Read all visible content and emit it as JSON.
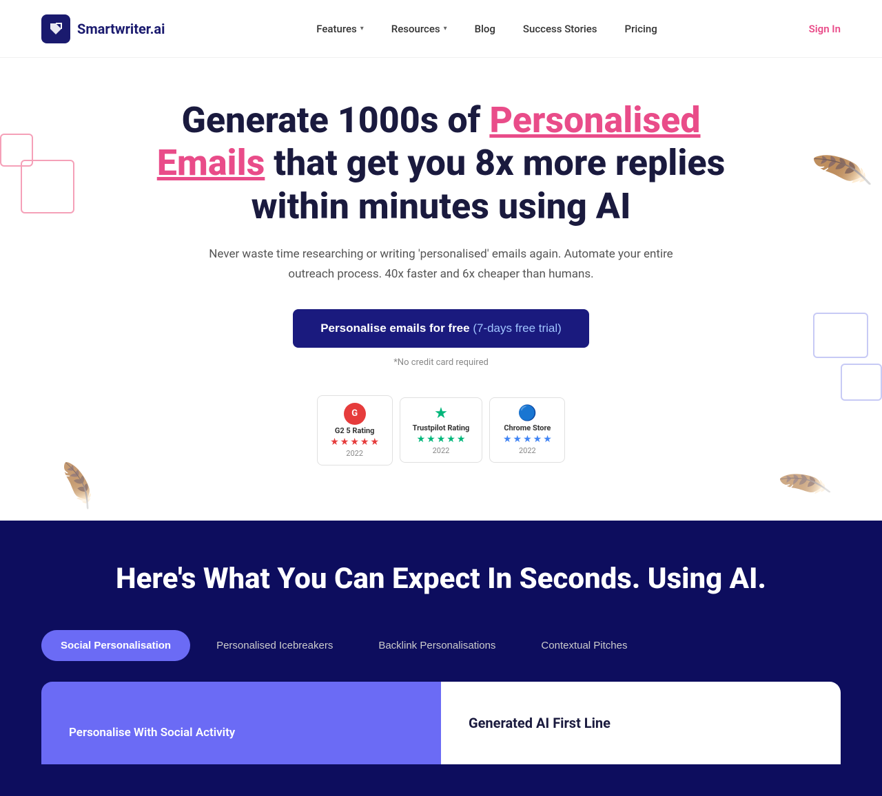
{
  "navbar": {
    "logo_text": "Smartwriter.ai",
    "nav_items": [
      {
        "label": "Features",
        "has_dropdown": true
      },
      {
        "label": "Resources",
        "has_dropdown": true
      },
      {
        "label": "Blog",
        "has_dropdown": false
      },
      {
        "label": "Success Stories",
        "has_dropdown": false
      },
      {
        "label": "Pricing",
        "has_dropdown": false
      }
    ],
    "sign_in": "Sign In"
  },
  "hero": {
    "title_start": "Generate 1000s of ",
    "title_highlight": "Personalised Emails",
    "title_end": " that get you 8x more replies within minutes using AI",
    "subtitle": "Never waste time researching or writing 'personalised' emails again. Automate your entire outreach process. 40x faster and 6x cheaper than humans.",
    "cta_label": "Personalise emails for free",
    "cta_trial": " (7-days free trial)",
    "no_cc": "*No credit card required",
    "ratings": [
      {
        "icon": "G2",
        "label": "G2 5 Rating",
        "stars": 5,
        "type": "g2",
        "year": "2022"
      },
      {
        "icon": "TP",
        "label": "Trustpilot Rating",
        "stars": 5,
        "type": "trustpilot",
        "year": "2022"
      },
      {
        "icon": "CS",
        "label": "Chrome Store",
        "stars": 5,
        "type": "chrome",
        "year": "2022"
      }
    ]
  },
  "dark_section": {
    "title": "Here's What You Can Expect In Seconds. Using AI.",
    "tabs": [
      {
        "label": "Social Personalisation",
        "active": true
      },
      {
        "label": "Personalised Icebreakers",
        "active": false
      },
      {
        "label": "Backlink Personalisations",
        "active": false
      },
      {
        "label": "Contextual Pitches",
        "active": false
      }
    ],
    "preview_left_label": "Personalise With Social Activity",
    "preview_right_label": "Generated AI First Line"
  }
}
